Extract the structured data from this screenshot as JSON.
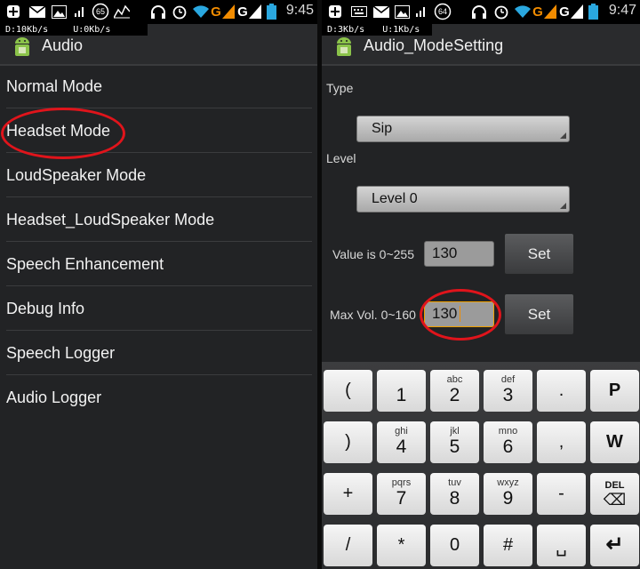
{
  "left": {
    "status": {
      "badge": "65",
      "time": "9:45",
      "carrier": "G",
      "carrier2": "G"
    },
    "netrate": {
      "down": "D:10Kb/s",
      "up": "U:0Kb/s"
    },
    "title": "Audio",
    "menu": [
      {
        "label": "Normal Mode"
      },
      {
        "label": "Headset Mode"
      },
      {
        "label": "LoudSpeaker Mode"
      },
      {
        "label": "Headset_LoudSpeaker Mode"
      },
      {
        "label": "Speech Enhancement"
      },
      {
        "label": "Debug Info"
      },
      {
        "label": "Speech Logger"
      },
      {
        "label": "Audio Logger"
      }
    ]
  },
  "right": {
    "status": {
      "badge": "64",
      "time": "9:47",
      "carrier": "G",
      "carrier2": "G"
    },
    "netrate": {
      "down": "D:3Kb/s",
      "up": "U:1Kb/s"
    },
    "title": "Audio_ModeSetting",
    "type_label": "Type",
    "type_value": "Sip",
    "level_label": "Level",
    "level_value": "Level 0",
    "value_label": "Value is 0~255",
    "value_input": "130",
    "maxvol_label": "Max Vol. 0~160",
    "maxvol_input": "130",
    "set_label": "Set",
    "keyboard": {
      "row1": [
        {
          "solo": "("
        },
        {
          "sub": "",
          "main": "1"
        },
        {
          "sub": "abc",
          "main": "2"
        },
        {
          "sub": "def",
          "main": "3"
        },
        {
          "solo": "."
        },
        {
          "solo": "P"
        }
      ],
      "row2": [
        {
          "solo": ")"
        },
        {
          "sub": "ghi",
          "main": "4"
        },
        {
          "sub": "jkl",
          "main": "5"
        },
        {
          "sub": "mno",
          "main": "6"
        },
        {
          "solo": ","
        },
        {
          "solo": "W"
        }
      ],
      "row3": [
        {
          "solo": "+"
        },
        {
          "sub": "pqrs",
          "main": "7"
        },
        {
          "sub": "tuv",
          "main": "8"
        },
        {
          "sub": "wxyz",
          "main": "9"
        },
        {
          "solo": "-"
        },
        {
          "sub": "DEL",
          "main": "⌫"
        }
      ],
      "row4": [
        {
          "solo": "/"
        },
        {
          "solo": "*"
        },
        {
          "solo": "0"
        },
        {
          "solo": "#"
        },
        {
          "solo": "␣"
        },
        {
          "solo": "↵"
        }
      ]
    }
  },
  "colors": {
    "highlight": "#e0141b",
    "background": "#222325",
    "accent": "#f28c00"
  }
}
